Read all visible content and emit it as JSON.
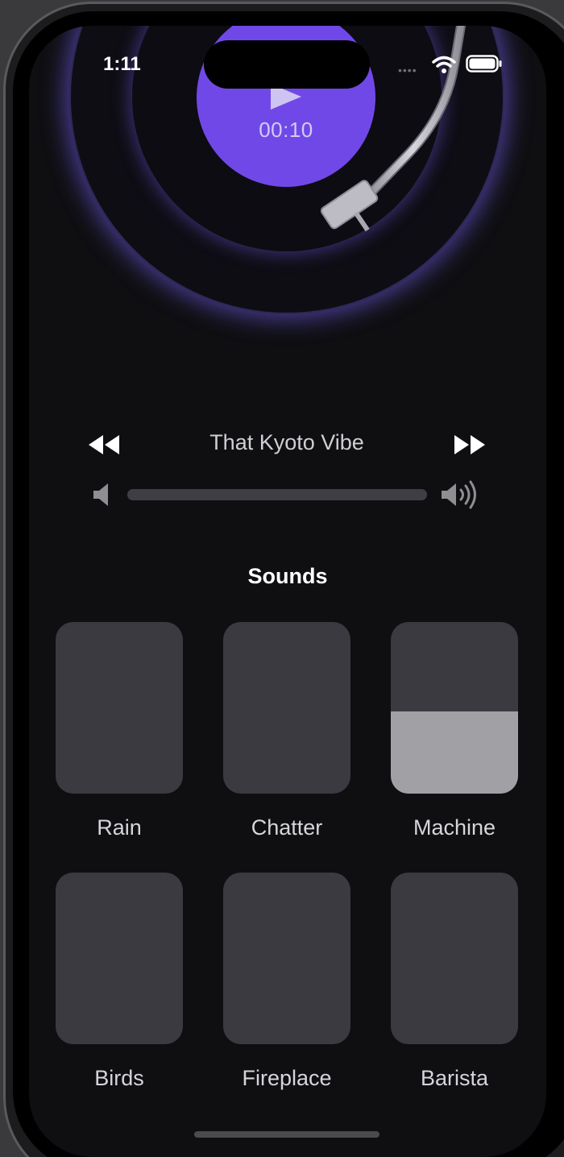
{
  "status_bar": {
    "time": "1:11",
    "signal": "••••"
  },
  "record": {
    "timer": "00:10",
    "accent_color": "#7148e8",
    "play_icon": "play-icon"
  },
  "player": {
    "track_title": "That Kyoto Vibe",
    "rewind_icon": "rewind-icon",
    "forward_icon": "fast-forward-icon",
    "volume_low_icon": "speaker-low-icon",
    "volume_high_icon": "speaker-high-icon"
  },
  "sounds": {
    "heading": "Sounds",
    "items": [
      {
        "label": "Rain",
        "level": 0
      },
      {
        "label": "Chatter",
        "level": 0
      },
      {
        "label": "Machine",
        "level": 0.48
      },
      {
        "label": "Birds",
        "level": 0
      },
      {
        "label": "Fireplace",
        "level": 0
      },
      {
        "label": "Barista",
        "level": 0
      }
    ]
  },
  "colors": {
    "background": "#0f0f12",
    "tile": "#3b3a40",
    "tile_fill": "#a1a1a5",
    "glow": "#7a64ff"
  }
}
